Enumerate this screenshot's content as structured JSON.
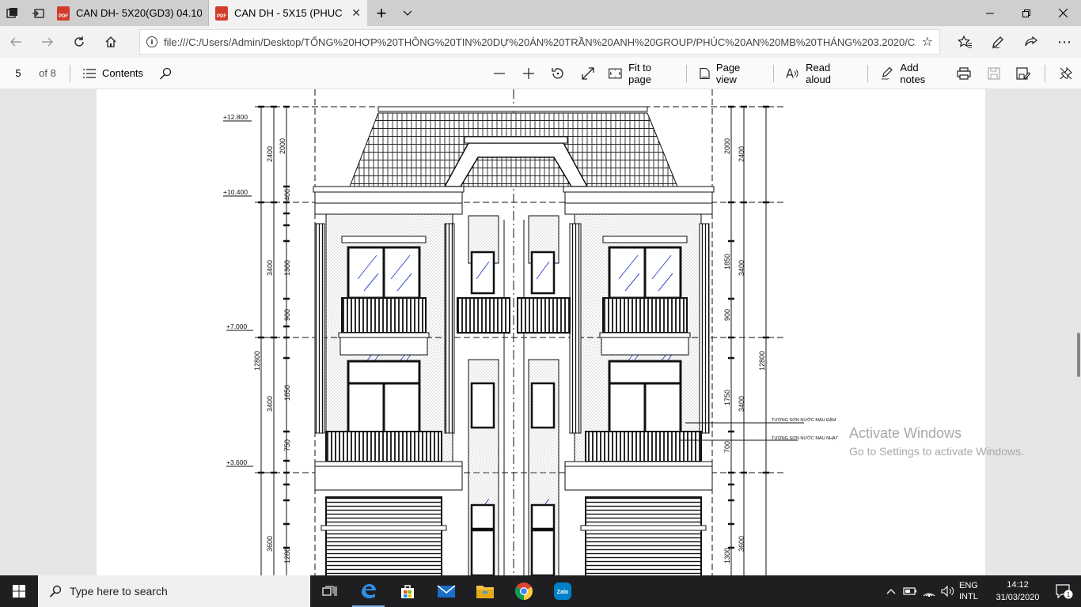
{
  "browser": {
    "tabs": [
      {
        "title": "CAN DH- 5X20(GD3) 04.10.p",
        "active": false
      },
      {
        "title": "CAN DH - 5X15 (PHUC .",
        "active": true
      }
    ],
    "url": "file:///C:/Users/Admin/Desktop/TỔNG%20HỢP%20THÔNG%20TIN%20DỰ%20ÁN%20TRẦN%20ANH%20GROUP/PHÚC%20AN%20MB%20THÁNG%203.2020/CAN%"
  },
  "pdf_toolbar": {
    "page_number": "5",
    "page_count": "of 8",
    "contents_label": "Contents",
    "fit_to_page_label": "Fit to page",
    "page_view_label": "Page view",
    "read_aloud_label": "Read aloud",
    "add_notes_label": "Add notes"
  },
  "drawing": {
    "levels": [
      "+12.800",
      "+10.400",
      "+7.000",
      "+3.600"
    ],
    "left_dims_outer": [
      "2400",
      "3400",
      "12800",
      "3400",
      "3600"
    ],
    "left_dims_inner": [
      "2000",
      "400",
      "300",
      "250",
      "350",
      "200",
      "1300",
      "900",
      "500",
      "100",
      "1850",
      "750",
      "300",
      "400",
      "200",
      "50",
      "50",
      "650",
      "120",
      "1280"
    ],
    "right_dims_outer": [
      "2400",
      "3400",
      "12800",
      "3400",
      "3600"
    ],
    "right_dims_inner": [
      "2000",
      "400",
      "250",
      "50",
      "250",
      "1850",
      "900",
      "600",
      "100",
      "1750",
      "50",
      "700",
      "100",
      "300",
      "400",
      "200",
      "50",
      "50",
      "650",
      "120",
      "1300"
    ],
    "notes": [
      "TƯỜNG SƠN NƯỚC MÀU ĐẬM",
      "TƯỜNG SƠN NƯỚC MÀU NHẠT"
    ]
  },
  "watermark": {
    "line1": "Activate Windows",
    "line2": "Go to Settings to activate Windows."
  },
  "taskbar": {
    "search_placeholder": "Type here to search",
    "zalo_label": "Zalo",
    "lang_line1": "ENG",
    "lang_line2": "INTL",
    "time": "14:12",
    "date": "31/03/2020",
    "notification_count": "1"
  }
}
